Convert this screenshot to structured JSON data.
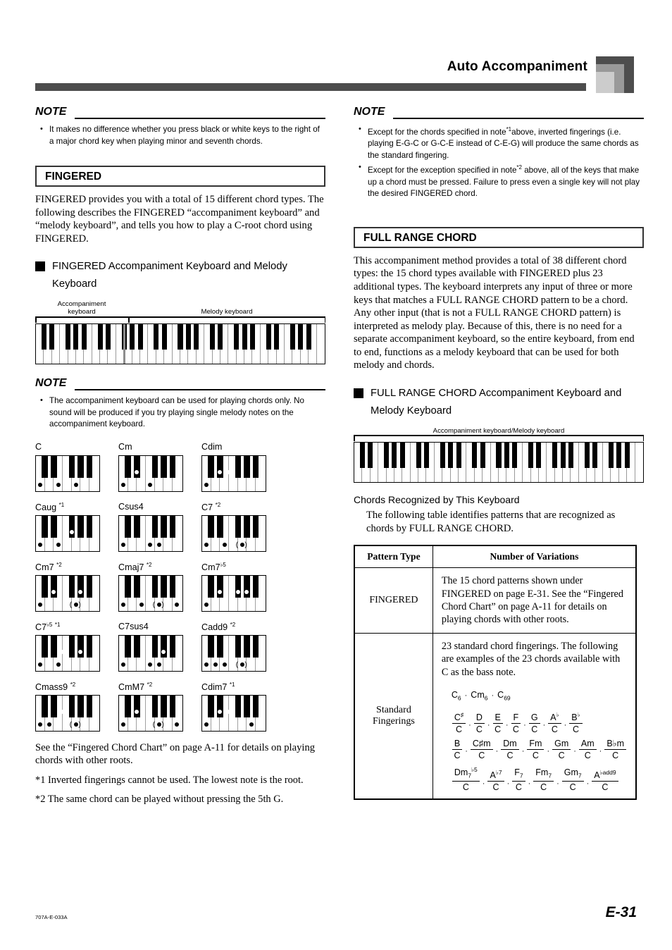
{
  "header": {
    "title": "Auto Accompaniment"
  },
  "footer": {
    "code": "707A-E-033A",
    "page": "E-31"
  },
  "left": {
    "note1": {
      "label": "NOTE",
      "items": [
        "It makes no difference whether you press black or white keys to the right of a major chord key when playing minor and seventh chords."
      ]
    },
    "section": {
      "title": "FINGERED",
      "body": "FINGERED provides you with a total of 15 different chord types. The following describes the FINGERED “accompaniment keyboard” and “melody keyboard”, and tells you how to play a C-root chord using FINGERED."
    },
    "subhead": "FINGERED Accompaniment Keyboard and Melody Keyboard",
    "keyboard": {
      "accomp_label_line1": "Accompaniment",
      "accomp_label_line2": "keyboard",
      "melody_label": "Melody keyboard"
    },
    "note2": {
      "label": "NOTE",
      "items": [
        "The accompaniment keyboard can be used for playing chords only. No sound will be produced if you try playing single melody notes on the accompaniment keyboard."
      ]
    },
    "tail": "See the “Fingered Chord Chart” on page A-11 for details on playing chords with other roots.",
    "starnotes": [
      "*1 Inverted fingerings cannot be used. The lowest note is the root.",
      "*2 The same chord can be played without pressing the 5th G."
    ]
  },
  "chords": [
    {
      "name": "C",
      "sup": "",
      "white_dots": [
        0,
        2,
        4
      ],
      "black_dots": [],
      "paren": []
    },
    {
      "name": "Cm",
      "sup": "",
      "white_dots": [
        0,
        3
      ],
      "black_dots": [
        1
      ],
      "paren": []
    },
    {
      "name": "Cdim",
      "sup": "",
      "white_dots": [
        0
      ],
      "black_dots": [
        1,
        2
      ],
      "paren": []
    },
    {
      "name": "Caug",
      "sup": "*1",
      "white_dots": [
        0,
        2
      ],
      "black_dots": [
        3
      ],
      "paren": []
    },
    {
      "name": "Csus4",
      "sup": "",
      "white_dots": [
        0,
        3,
        4
      ],
      "black_dots": [],
      "paren": []
    },
    {
      "name": "C7",
      "sup": "*2",
      "white_dots": [
        0,
        2,
        4
      ],
      "black_dots": [],
      "paren": [
        4
      ]
    },
    {
      "name": "Cm7",
      "sup": "*2",
      "white_dots": [
        0,
        4
      ],
      "black_dots": [
        1,
        4
      ],
      "paren": [
        4
      ]
    },
    {
      "name": "Cmaj7",
      "sup": "*2",
      "white_dots": [
        0,
        2,
        4,
        6
      ],
      "black_dots": [],
      "paren": [
        4
      ]
    },
    {
      "name": "Cm7♭5",
      "sup": "",
      "white_dots": [
        0
      ],
      "black_dots": [
        1,
        3,
        4
      ],
      "paren": []
    },
    {
      "name": "C7♭5",
      "sup": "*1",
      "white_dots": [
        0,
        2
      ],
      "black_dots": [
        2,
        4
      ],
      "paren": []
    },
    {
      "name": "C7sus4",
      "sup": "",
      "white_dots": [
        0,
        3,
        4
      ],
      "black_dots": [
        4
      ],
      "paren": []
    },
    {
      "name": "Cadd9",
      "sup": "*2",
      "white_dots": [
        0,
        1,
        2,
        4
      ],
      "black_dots": [],
      "paren": [
        4
      ]
    },
    {
      "name": "Cmass9",
      "sup": "*2",
      "white_dots": [
        0,
        1,
        4
      ],
      "black_dots": [
        2
      ],
      "paren": [
        4
      ]
    },
    {
      "name": "CmM7",
      "sup": "*2",
      "white_dots": [
        0,
        4,
        6
      ],
      "black_dots": [
        1
      ],
      "paren": [
        4
      ]
    },
    {
      "name": "Cdim7",
      "sup": "*1",
      "white_dots": [
        0,
        5
      ],
      "black_dots": [
        1,
        2
      ],
      "paren": []
    }
  ],
  "right": {
    "note1": {
      "label": "NOTE",
      "items": [
        "Except for the chords specified in note*1above, inverted fingerings (i.e. playing E-G-C or G-C-E instead of C-E-G) will produce the same chords as the standard fingering.",
        "Except for the exception specified in note*2 above, all of the keys that make up a chord must be pressed. Failure to press even a single key will not play the desired FINGERED chord."
      ]
    },
    "section": {
      "title": "FULL RANGE CHORD",
      "body": "This accompaniment method provides a total of 38 different chord types: the 15 chord types available with FINGERED plus 23 additional types. The keyboard interprets any input of three or more keys that matches a FULL RANGE CHORD pattern to be a chord. Any other input (that is not a FULL RANGE CHORD pattern) is interpreted as melody play. Because of this, there is no need for a separate accompaniment keyboard, so the entire keyboard, from end to end, functions as a melody keyboard that can be used for both melody and chords."
    },
    "subhead": "FULL RANGE CHORD Accompaniment Keyboard and Melody Keyboard",
    "keyboard": {
      "label": "Accompaniment keyboard/Melody keyboard"
    },
    "recognized_head": "Chords Recognized by This Keyboard",
    "recognized_body": "The following table identifies patterns that are recognized as chords by FULL RANGE CHORD.",
    "table": {
      "headers": [
        "Pattern Type",
        "Number of Variations"
      ],
      "rows": [
        {
          "type": "FINGERED",
          "desc": "The 15 chord patterns shown under FINGERED on page E-31. See the “Fingered Chord Chart” on page A-11 for details on playing chords with other roots."
        },
        {
          "type_line1": "Standard",
          "type_line2": "Fingerings",
          "desc": "23 standard chord fingerings. The following are examples of the 23 chords available with C as the bass note."
        }
      ]
    },
    "chord_examples": {
      "line0": [
        {
          "base": "C",
          "sub": "6"
        },
        {
          "base": "Cm",
          "sub": "6"
        },
        {
          "base": "C",
          "sub": "69"
        }
      ],
      "line1": [
        {
          "num": "C",
          "numsup": "♯",
          "numsub": "",
          "den": "C"
        },
        {
          "num": "D",
          "numsup": "",
          "numsub": "",
          "den": "C"
        },
        {
          "num": "E",
          "numsup": "",
          "numsub": "",
          "den": "C"
        },
        {
          "num": "F",
          "numsup": "",
          "numsub": "",
          "den": "C"
        },
        {
          "num": "G",
          "numsup": "",
          "numsub": "",
          "den": "C"
        },
        {
          "num": "A",
          "numsup": "♭",
          "numsub": "",
          "den": "C"
        },
        {
          "num": "B",
          "numsup": "♭",
          "numsub": "",
          "den": "C"
        }
      ],
      "line2": [
        {
          "num": "B",
          "numsup": "",
          "numsub": "",
          "den": "C"
        },
        {
          "num": "C♯m",
          "numsup": "",
          "numsub": "",
          "den": "C"
        },
        {
          "num": "Dm",
          "numsup": "",
          "numsub": "",
          "den": "C"
        },
        {
          "num": "Fm",
          "numsup": "",
          "numsub": "",
          "den": "C"
        },
        {
          "num": "Gm",
          "numsup": "",
          "numsub": "",
          "den": "C"
        },
        {
          "num": "Am",
          "numsup": "",
          "numsub": "",
          "den": "C"
        },
        {
          "num": "B♭m",
          "numsup": "",
          "numsub": "",
          "den": "C"
        }
      ],
      "line3": [
        {
          "num": "Dm",
          "numsup": "♭5",
          "numsub": "7",
          "den": "C"
        },
        {
          "num": "A",
          "numsup": "♭7",
          "numsub": "",
          "den": "C"
        },
        {
          "num": "F",
          "numsup": "",
          "numsub": "7",
          "den": "C"
        },
        {
          "num": "Fm",
          "numsup": "",
          "numsub": "7",
          "den": "C"
        },
        {
          "num": "Gm",
          "numsup": "",
          "numsub": "7",
          "den": "C"
        },
        {
          "num": "A",
          "numsup": "♭add9",
          "numsub": "",
          "den": "C"
        }
      ]
    }
  }
}
